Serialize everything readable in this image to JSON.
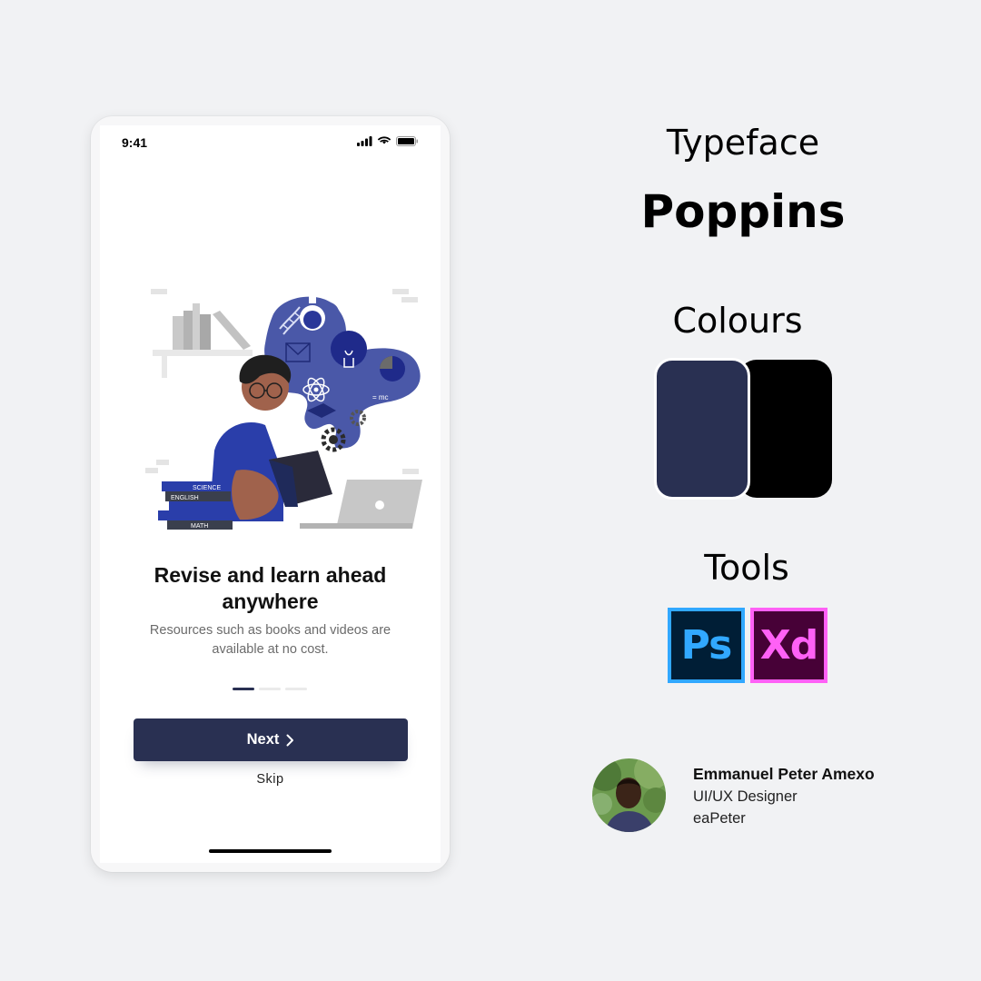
{
  "phone": {
    "status_time": "9:41",
    "title": "Revise and learn ahead anywhere",
    "subtitle": "Resources such as books and videos are available at no cost.",
    "next_label": "Next",
    "skip_label": "Skip",
    "page_indicator": {
      "current": 1,
      "total": 3
    },
    "illustration": {
      "book_labels": [
        "SCIENCE",
        "ENGLISH",
        "MATH"
      ],
      "formula_text": "= mc"
    }
  },
  "info": {
    "typeface_label": "Typeface",
    "typeface_name": "Poppins",
    "colours_label": "Colours",
    "colours": [
      "#293052",
      "#000000"
    ],
    "tools_label": "Tools",
    "tools": [
      {
        "label": "Ps",
        "icon": "photoshop-icon"
      },
      {
        "label": "Xd",
        "icon": "adobe-xd-icon"
      }
    ]
  },
  "author": {
    "name": "Emmanuel Peter Amexo",
    "role": "UI/UX Designer",
    "handle": "eaPeter"
  },
  "colors": {
    "primary": "#293052",
    "accent_blue": "#3b4aa8",
    "ps_blue": "#31a8ff",
    "xd_pink": "#ff61f6"
  }
}
